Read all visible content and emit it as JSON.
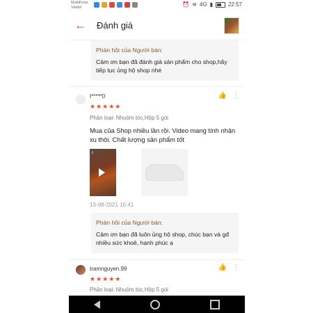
{
  "status_bar": {
    "carrier_line1": "MobiFone",
    "carrier_line2": "Viettel",
    "signal": "4G",
    "time": "22:57",
    "app_icon_colors": [
      "#2d8ae8",
      "#e8a030",
      "#e8453c",
      "#3f8fd6",
      "#d63f3f",
      "#888888"
    ]
  },
  "header": {
    "back_icon": "arrow-left-icon",
    "title": "Đánh giá"
  },
  "reply_top": {
    "label": "Phản hồi của Người bán:",
    "text": "Cảm ơn bạn đã đánh giá sản phẩm cho shop,hãy tiếp tục ủng hộ shop nhé"
  },
  "review1": {
    "username": "t*****0",
    "rating": "★★★★★",
    "variant": "Phân loại: Nhuộm tóc,Hộp 5 gói",
    "comment": "Mua của Shop nhiều lần rồi. Video mang tính nhận xu thôi. Chất lượng sản phẩm tốt",
    "date": "13-08-2021 16:41",
    "reply_label": "Phản hồi của Người bán:",
    "reply_text": "Cảm ơn bạn đã luôn ủng hộ shop, chúc bạn và gđ nhiều sức khoẻ, hạnh phúc ạ"
  },
  "review2": {
    "username": "tramnguyen.99",
    "rating": "★★★★★",
    "variant": "Phân loại: Nhuộm tóc,Hộp 5 gói"
  },
  "accent_color": "#ee4d2d"
}
